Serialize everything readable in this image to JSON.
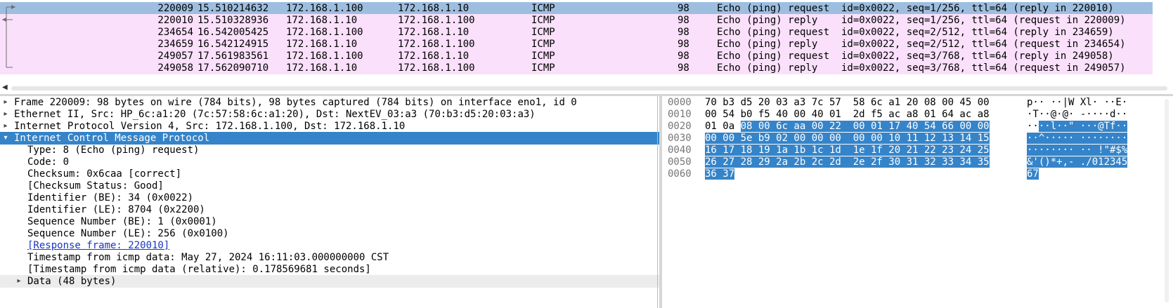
{
  "packets": [
    {
      "no": "220009",
      "time": "15.510214632",
      "src": "172.168.1.100",
      "dst": "172.168.1.10",
      "proto": "ICMP",
      "len": "98",
      "info": "Echo (ping) request  id=0x0022, seq=1/256, ttl=64 (reply in 220010)",
      "selected": true
    },
    {
      "no": "220010",
      "time": "15.510328936",
      "src": "172.168.1.10",
      "dst": "172.168.1.100",
      "proto": "ICMP",
      "len": "98",
      "info": "Echo (ping) reply    id=0x0022, seq=1/256, ttl=64 (request in 220009)",
      "selected": false
    },
    {
      "no": "234654",
      "time": "16.542005425",
      "src": "172.168.1.100",
      "dst": "172.168.1.10",
      "proto": "ICMP",
      "len": "98",
      "info": "Echo (ping) request  id=0x0022, seq=2/512, ttl=64 (reply in 234659)",
      "selected": false
    },
    {
      "no": "234659",
      "time": "16.542124915",
      "src": "172.168.1.10",
      "dst": "172.168.1.100",
      "proto": "ICMP",
      "len": "98",
      "info": "Echo (ping) reply    id=0x0022, seq=2/512, ttl=64 (request in 234654)",
      "selected": false
    },
    {
      "no": "249057",
      "time": "17.561983561",
      "src": "172.168.1.100",
      "dst": "172.168.1.10",
      "proto": "ICMP",
      "len": "98",
      "info": "Echo (ping) request  id=0x0022, seq=3/768, ttl=64 (reply in 249058)",
      "selected": false
    },
    {
      "no": "249058",
      "time": "17.562090710",
      "src": "172.168.1.10",
      "dst": "172.168.1.100",
      "proto": "ICMP",
      "len": "98",
      "info": "Echo (ping) reply    id=0x0022, seq=3/768, ttl=64 (request in 249057)",
      "selected": false
    }
  ],
  "details": [
    {
      "text": "Frame 220009: 98 bytes on wire (784 bits), 98 bytes captured (784 bits) on interface eno1, id 0",
      "level": 0,
      "toggle": "collapsed",
      "style": "normal"
    },
    {
      "text": "Ethernet II, Src: HP_6c:a1:20 (7c:57:58:6c:a1:20), Dst: NextEV_03:a3 (70:b3:d5:20:03:a3)",
      "level": 0,
      "toggle": "collapsed",
      "style": "normal"
    },
    {
      "text": "Internet Protocol Version 4, Src: 172.168.1.100, Dst: 172.168.1.10",
      "level": 0,
      "toggle": "collapsed",
      "style": "normal"
    },
    {
      "text": "Internet Control Message Protocol",
      "level": 0,
      "toggle": "expanded",
      "style": "selected"
    },
    {
      "text": "Type: 8 (Echo (ping) request)",
      "level": 1,
      "toggle": "none",
      "style": "normal"
    },
    {
      "text": "Code: 0",
      "level": 1,
      "toggle": "none",
      "style": "normal"
    },
    {
      "text": "Checksum: 0x6caa [correct]",
      "level": 1,
      "toggle": "none",
      "style": "normal"
    },
    {
      "text": "[Checksum Status: Good]",
      "level": 1,
      "toggle": "none",
      "style": "normal"
    },
    {
      "text": "Identifier (BE): 34 (0x0022)",
      "level": 1,
      "toggle": "none",
      "style": "normal"
    },
    {
      "text": "Identifier (LE): 8704 (0x2200)",
      "level": 1,
      "toggle": "none",
      "style": "normal"
    },
    {
      "text": "Sequence Number (BE): 1 (0x0001)",
      "level": 1,
      "toggle": "none",
      "style": "normal"
    },
    {
      "text": "Sequence Number (LE): 256 (0x0100)",
      "level": 1,
      "toggle": "none",
      "style": "normal"
    },
    {
      "text": "[Response frame: 220010]",
      "level": 1,
      "toggle": "none",
      "style": "link"
    },
    {
      "text": "Timestamp from icmp data: May 27, 2024 16:11:03.000000000 CST",
      "level": 1,
      "toggle": "none",
      "style": "normal"
    },
    {
      "text": "[Timestamp from icmp data (relative): 0.178569681 seconds]",
      "level": 1,
      "toggle": "none",
      "style": "normal"
    },
    {
      "text": "Data (48 bytes)",
      "level": 1,
      "toggle": "collapsed",
      "style": "gray"
    }
  ],
  "bytes": [
    {
      "offset": "0000",
      "hex_plain": "70 b3 d5 20 03 a3 7c 57  58 6c a1 20 08 00 45 00",
      "hex_hl": "",
      "ascii_plain": "p·· ··|W Xl· ··E·",
      "ascii_hl": ""
    },
    {
      "offset": "0010",
      "hex_plain": "00 54 b0 f5 40 00 40 01  2d f5 ac a8 01 64 ac a8",
      "hex_hl": "",
      "ascii_plain": "·T··@·@· -····d··",
      "ascii_hl": ""
    },
    {
      "offset": "0020",
      "hex_plain": "01 0a ",
      "hex_hl": "08 00 6c aa 00 22  00 01 17 40 54 66 00 00",
      "ascii_plain": "··",
      "ascii_hl": "··l··\" ···@Tf··"
    },
    {
      "offset": "0030",
      "hex_plain": "",
      "hex_hl": "00 00 5e b9 02 00 00 00  00 00 10 11 12 13 14 15",
      "ascii_plain": "",
      "ascii_hl": "··^····· ········"
    },
    {
      "offset": "0040",
      "hex_plain": "",
      "hex_hl": "16 17 18 19 1a 1b 1c 1d  1e 1f 20 21 22 23 24 25",
      "ascii_plain": "",
      "ascii_hl": "········ ·· !\"#$%"
    },
    {
      "offset": "0050",
      "hex_plain": "",
      "hex_hl": "26 27 28 29 2a 2b 2c 2d  2e 2f 30 31 32 33 34 35",
      "ascii_plain": "",
      "ascii_hl": "&'()*+,- ./012345"
    },
    {
      "offset": "0060",
      "hex_plain": "",
      "hex_hl": "36 37",
      "ascii_plain": "",
      "ascii_hl": "67"
    }
  ],
  "colors": {
    "selected_packet": "#9dbedf",
    "icmp_row": "#fae0fa",
    "tree_selected": "#3584c9",
    "byte_highlight": "#3584c9",
    "link": "#1a35c6"
  },
  "icons": {
    "collapsed": "triangle-right-icon",
    "expanded": "triangle-down-icon",
    "scroll_left": "scroll-left-icon"
  }
}
